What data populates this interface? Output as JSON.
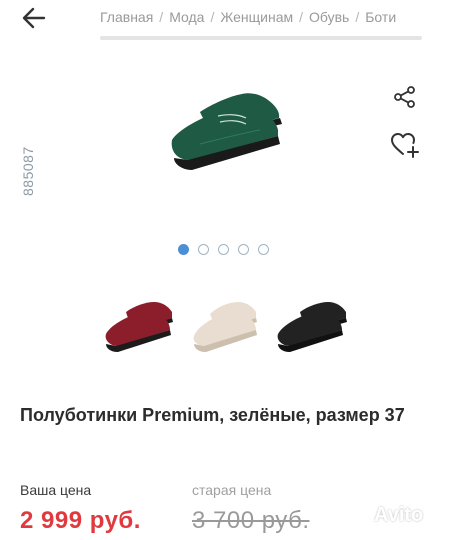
{
  "breadcrumb": {
    "items": [
      "Главная",
      "Мода",
      "Женщинам",
      "Обувь",
      "Боти"
    ],
    "separator": "/"
  },
  "product": {
    "article_code": "885087",
    "title": "Полуботинки Premium, зелёные, размер 37",
    "main_color": "#1f5a45",
    "variants": [
      {
        "color_name": "бордовые",
        "color": "#8c1e2c"
      },
      {
        "color_name": "бежевые",
        "color": "#e8ddd0"
      },
      {
        "color_name": "чёрные",
        "color": "#222222"
      }
    ]
  },
  "gallery": {
    "total_images": 5,
    "active_index": 0
  },
  "pricing": {
    "current_label": "Ваша цена",
    "current_price": "2 999 руб.",
    "old_label": "старая цена",
    "old_price": "3 700 руб."
  },
  "icons": {
    "back": "arrow-left-icon",
    "share": "share-icon",
    "favorite": "heart-plus-icon"
  },
  "watermark": {
    "text": "Avito"
  },
  "colors": {
    "accent": "#4b8fd6",
    "price": "#e0393e"
  }
}
